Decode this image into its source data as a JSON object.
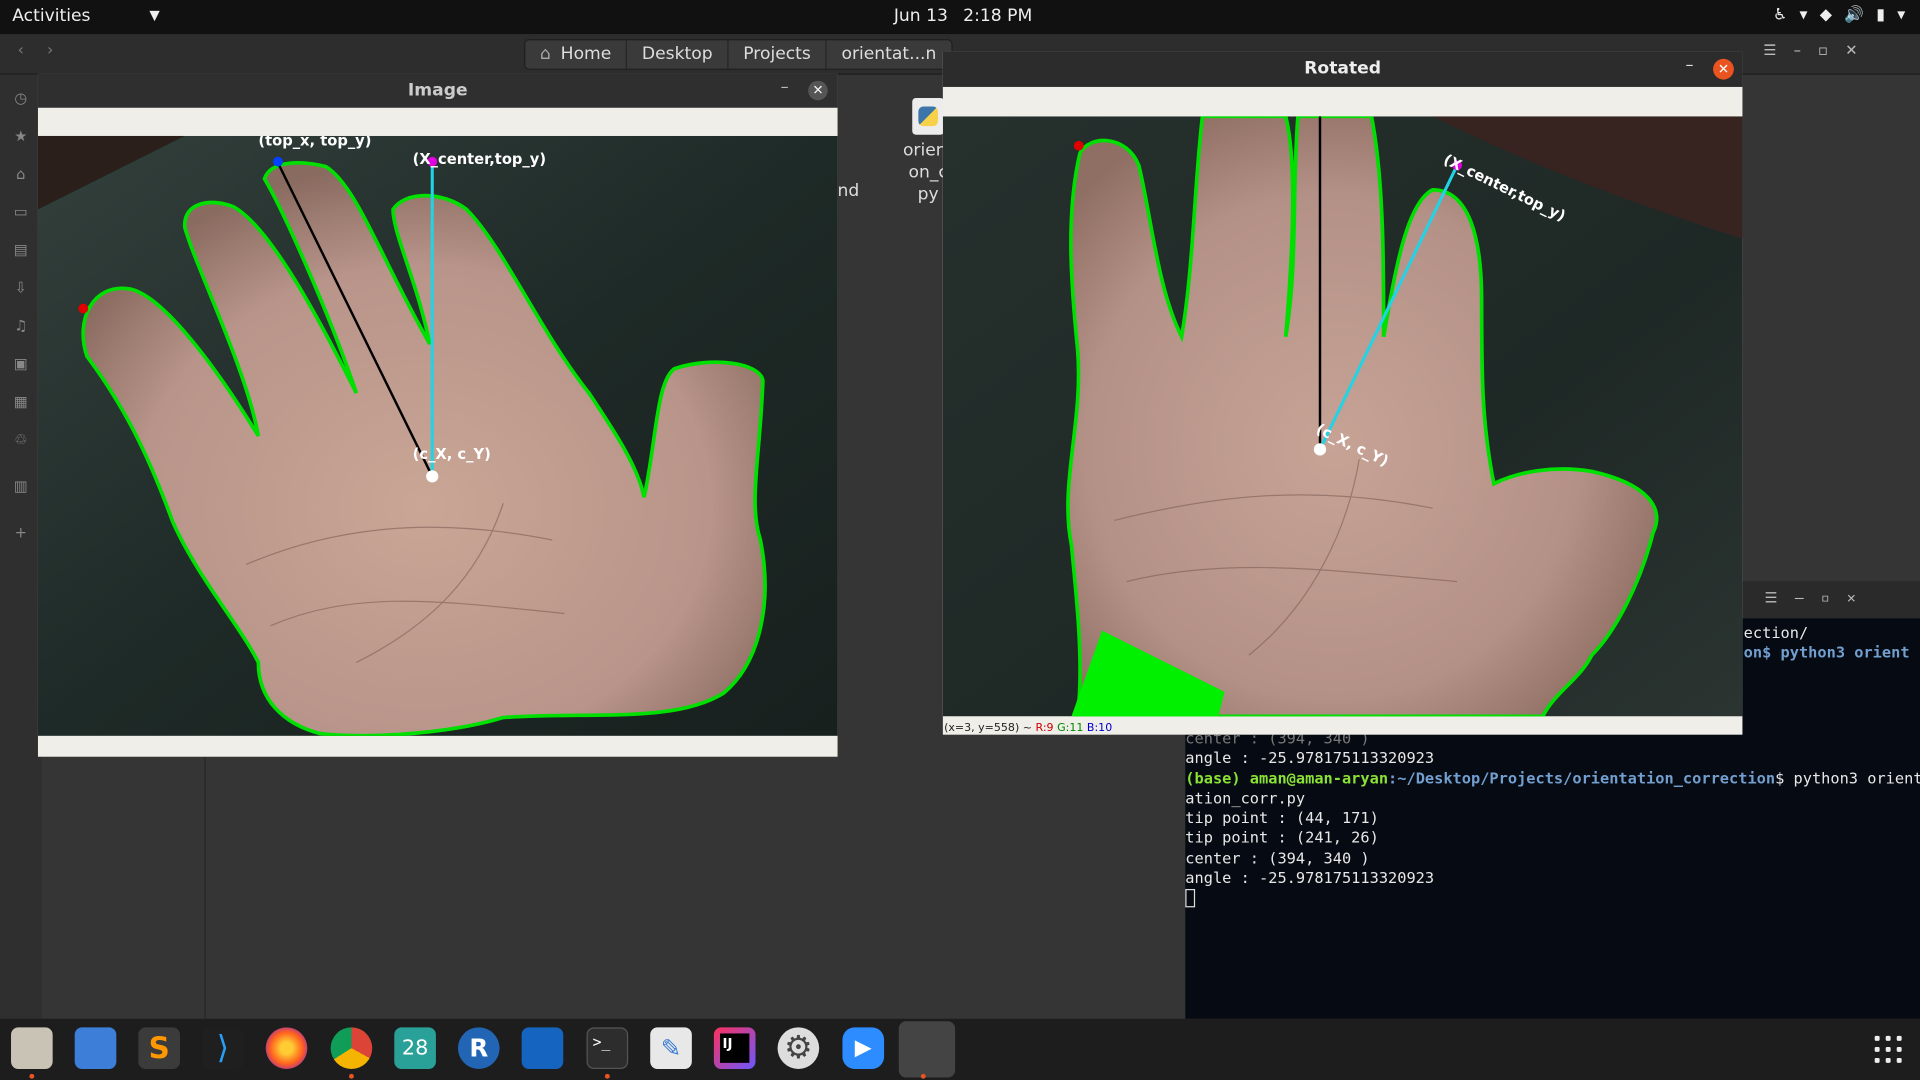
{
  "topbar": {
    "activities": "Activities",
    "date": "Jun 13",
    "time": "2:18 PM"
  },
  "files": {
    "breadcrumbs": [
      "Home",
      "Desktop",
      "Projects",
      "orientat...n"
    ],
    "desktop_file_lines": [
      "orient",
      "on_c",
      "py"
    ],
    "partial_text": "nd"
  },
  "image_window": {
    "title": "Image",
    "labels": {
      "top": "(top_x, top_y)",
      "center_top": "(X_center,top_y)",
      "center": "(c_X, c_Y)"
    }
  },
  "rotated_window": {
    "title": "Rotated",
    "labels": {
      "center_top": "(X_center,top_y)",
      "center": "(c_X, c_Y)"
    },
    "status": {
      "coords": "(x=3, y=558) ~",
      "r": "R:9",
      "g": "G:11",
      "b": "B:10"
    }
  },
  "terminal": {
    "top_lines": [
      "ection/",
      "on$ python3 orient"
    ],
    "lines_before": [
      "center : (394, 340 )",
      "angle : -25.978175113320923"
    ],
    "prompt_user": "(base) aman@aman-aryan",
    "prompt_path": ":~/Desktop/Projects/orientation_correction",
    "prompt_cmd": "$ python3 orient",
    "cmd_wrap": "ation_corr.py",
    "output": [
      "tip point : (44, 171)",
      "tip point : (241, 26)",
      "center : (394, 340 )",
      "angle : -25.978175113320923"
    ]
  },
  "dock": {
    "calendar_day": "28",
    "r_label": "R",
    "ij_label": "IJ",
    "terminal_label": ">_"
  },
  "colors": {
    "accent": "#e95420",
    "contour": "#00e000",
    "cyan_line": "#22d3e6",
    "magenta_point": "#e000e0"
  }
}
